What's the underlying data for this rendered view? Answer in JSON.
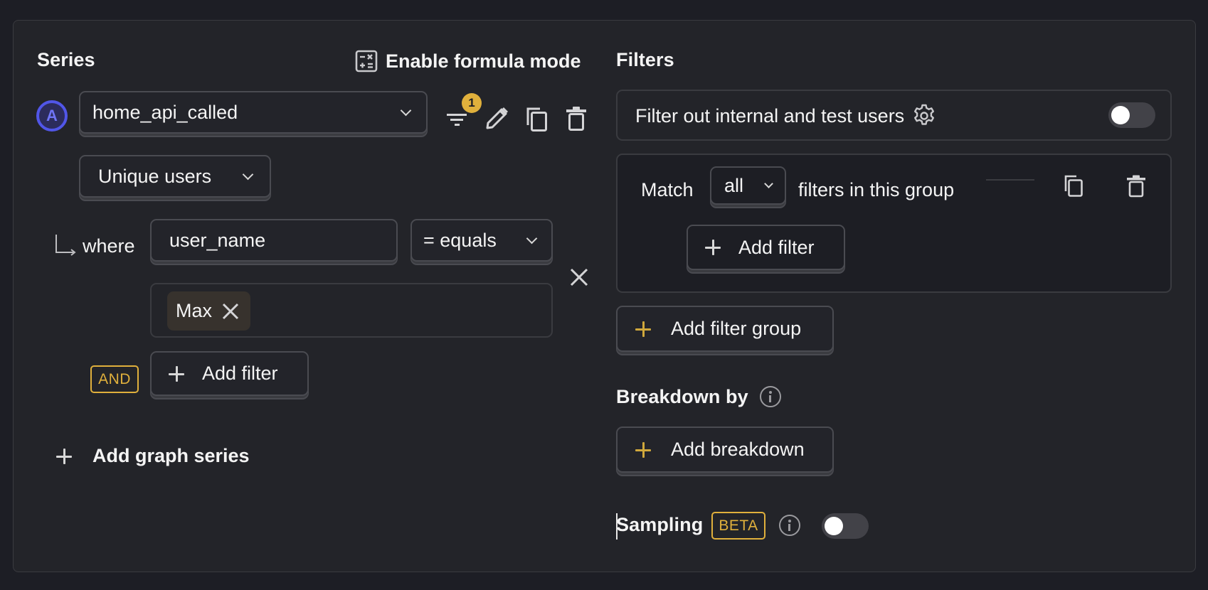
{
  "series": {
    "title": "Series",
    "formula_mode_label": "Enable formula mode",
    "items": [
      {
        "letter": "A",
        "event": "home_api_called",
        "filter_count": "1",
        "aggregation": "Unique users",
        "filters": [
          {
            "connector": "where",
            "property": "user_name",
            "operator": "= equals",
            "values": [
              "Max"
            ]
          }
        ],
        "and_label": "AND",
        "add_filter_label": "Add filter"
      }
    ],
    "add_series_label": "Add graph series"
  },
  "filters": {
    "title": "Filters",
    "internal_users_label": "Filter out internal and test users",
    "internal_users_enabled": false,
    "group": {
      "match_prefix": "Match",
      "match_value": "all",
      "match_suffix": "filters in this group",
      "add_filter_label": "Add filter"
    },
    "add_filter_group_label": "Add filter group"
  },
  "breakdown": {
    "title": "Breakdown by",
    "add_label": "Add breakdown"
  },
  "sampling": {
    "label": "Sampling",
    "badge": "BETA",
    "enabled": false
  },
  "colors": {
    "accent_series": "#5156e8",
    "warning_badge": "#e0b03c",
    "chip_bg": "#37322d"
  }
}
